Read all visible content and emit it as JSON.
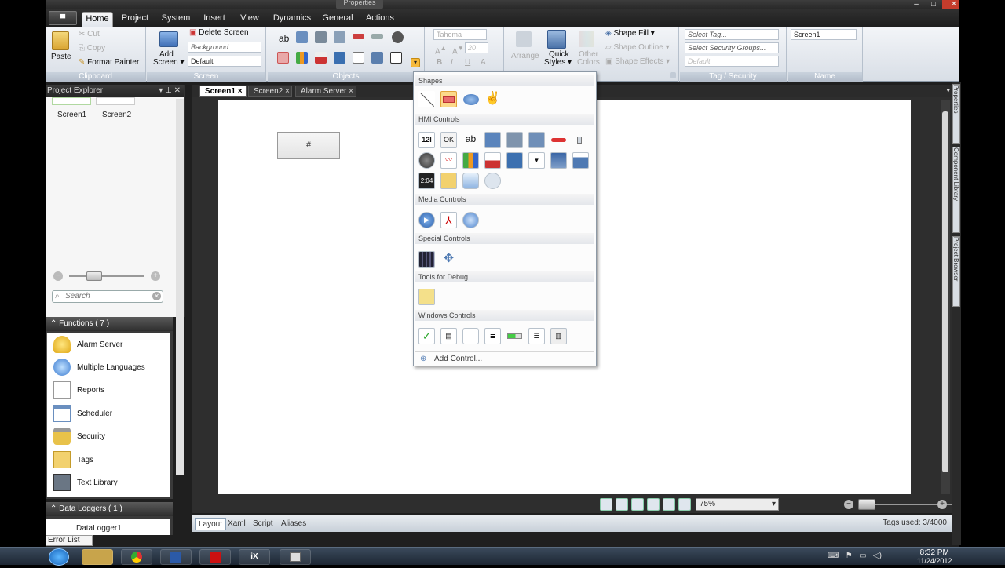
{
  "window": {
    "title": "Properties",
    "controls": [
      "–",
      "□",
      "✕"
    ]
  },
  "app_menu": {
    "label": "▀"
  },
  "ribbon_tabs": [
    "Home",
    "Project",
    "System",
    "Insert",
    "View",
    "Dynamics",
    "General",
    "Actions"
  ],
  "clipboard": {
    "paste": "Paste",
    "cut": "Cut",
    "copy": "Copy",
    "format_painter": "Format Painter",
    "label": "Clipboard"
  },
  "screen": {
    "add_screen": "Add",
    "add_screen_2": "Screen ▾",
    "delete_screen": "Delete Screen",
    "background": "Background...",
    "default": "Default",
    "label": "Screen"
  },
  "objects": {
    "label": "Objects",
    "text_glyph": "ab"
  },
  "font": {
    "name": "Tahoma",
    "size": "20",
    "bold": "B",
    "italic": "I",
    "underline": "U",
    "font_color": "A"
  },
  "arrange": {
    "arrange": "Arrange",
    "quick": "Quick",
    "styles": "Styles ▾",
    "other": "Other",
    "colors": "Colors",
    "shape_fill": "Shape Fill ▾",
    "shape_outline": "Shape Outline ▾",
    "shape_effects": "Shape Effects ▾"
  },
  "tag_security": {
    "select_tag": "Select Tag...",
    "select_security": "Select Security Groups...",
    "default": "Default",
    "label": "Tag / Security"
  },
  "name_group": {
    "value": "Screen1",
    "label": "Name"
  },
  "project_explorer": {
    "title": "Project Explorer",
    "header_buttons": "▾ ⊥ ✕",
    "thumbs": [
      "Screen1",
      "Screen2"
    ],
    "search_placeholder": "Search",
    "zoom_minus": "−",
    "zoom_plus": "+"
  },
  "functions": {
    "header": "Functions ( 7 )",
    "items": [
      {
        "label": "Alarm Server"
      },
      {
        "label": "Multiple Languages"
      },
      {
        "label": "Reports"
      },
      {
        "label": "Scheduler"
      },
      {
        "label": "Security"
      },
      {
        "label": "Tags"
      },
      {
        "label": "Text Library"
      }
    ]
  },
  "data_loggers": {
    "header": "Data Loggers ( 1 )",
    "item": "DataLogger1"
  },
  "error_list": "Error List",
  "doc_tabs": [
    "Screen1 ×",
    "Screen2 ×",
    "Alarm Server ×"
  ],
  "canvas": {
    "button_text": "#"
  },
  "zoom": {
    "value": "75%"
  },
  "bottom_tabs": [
    "Layout",
    "Xaml",
    "Script",
    "Aliases"
  ],
  "tags_used": "Tags used: 3/4000",
  "right_tabs": [
    "Properties",
    "Component Library",
    "Project Browser"
  ],
  "dropdown": {
    "sections": [
      "Shapes",
      "HMI Controls",
      "Media Controls",
      "Special Controls",
      "Tools for Debug",
      "Windows Controls"
    ],
    "hmi_labels": [
      "12I",
      "OK",
      "ab"
    ],
    "add_control": "Add Control..."
  },
  "taskbar": {
    "time": "8:32 PM",
    "date": "11/24/2012",
    "ix_label": "iX"
  }
}
